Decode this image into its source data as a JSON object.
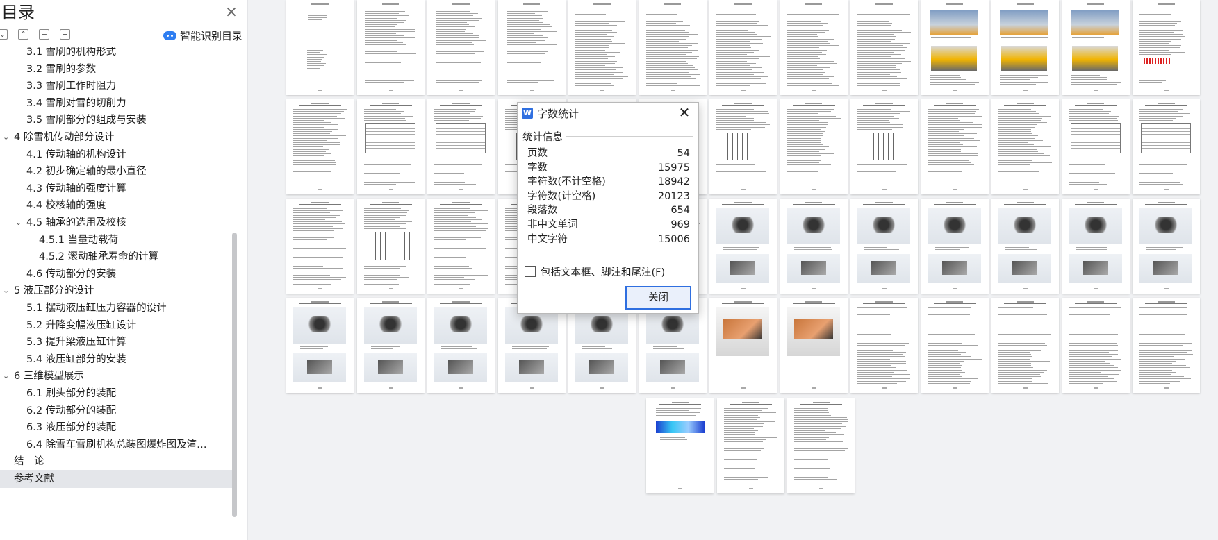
{
  "toc": {
    "title": "目录",
    "smart_toc_label": "智能识别目录",
    "items": [
      {
        "label": "3.1 雪刷的机构形式",
        "level": 1,
        "expandable": false,
        "selected": false
      },
      {
        "label": "3.2 雪刷的参数",
        "level": 1,
        "expandable": false,
        "selected": false
      },
      {
        "label": "3.3 雪刷工作时阻力",
        "level": 1,
        "expandable": false,
        "selected": false
      },
      {
        "label": "3.4 雪刷对雪的切削力",
        "level": 1,
        "expandable": false,
        "selected": false
      },
      {
        "label": "3.5 雪刷部分的组成与安装",
        "level": 1,
        "expandable": false,
        "selected": false
      },
      {
        "label": "4 除雪机传动部分设计",
        "level": 0,
        "expandable": true,
        "selected": false
      },
      {
        "label": "4.1 传动轴的机构设计",
        "level": 1,
        "expandable": false,
        "selected": false
      },
      {
        "label": "4.2 初步确定轴的最小直径",
        "level": 1,
        "expandable": false,
        "selected": false
      },
      {
        "label": "4.3 传动轴的强度计算",
        "level": 1,
        "expandable": false,
        "selected": false
      },
      {
        "label": "4.4 校核轴的强度",
        "level": 1,
        "expandable": false,
        "selected": false
      },
      {
        "label": "4.5 轴承的选用及校核",
        "level": 1,
        "expandable": true,
        "selected": false
      },
      {
        "label": "4.5.1 当量动载荷",
        "level": 2,
        "expandable": false,
        "selected": false
      },
      {
        "label": "4.5.2 滚动轴承寿命的计算",
        "level": 2,
        "expandable": false,
        "selected": false
      },
      {
        "label": "4.6 传动部分的安装",
        "level": 1,
        "expandable": false,
        "selected": false
      },
      {
        "label": "5 液压部分的设计",
        "level": 0,
        "expandable": true,
        "selected": false
      },
      {
        "label": "5.1 摆动液压缸压力容器的设计",
        "level": 1,
        "expandable": false,
        "selected": false
      },
      {
        "label": "5.2 升降变幅液压缸设计",
        "level": 1,
        "expandable": false,
        "selected": false
      },
      {
        "label": "5.3 提升梁液压缸计算",
        "level": 1,
        "expandable": false,
        "selected": false
      },
      {
        "label": "5.4 液压缸部分的安装",
        "level": 1,
        "expandable": false,
        "selected": false
      },
      {
        "label": "6 三维模型展示",
        "level": 0,
        "expandable": true,
        "selected": false
      },
      {
        "label": "6.1 刷头部分的装配",
        "level": 1,
        "expandable": false,
        "selected": false
      },
      {
        "label": "6.2 传动部分的装配",
        "level": 1,
        "expandable": false,
        "selected": false
      },
      {
        "label": "6.3 液压部分的装配",
        "level": 1,
        "expandable": false,
        "selected": false
      },
      {
        "label": "6.4 除雪车雪刷机构总装图爆炸图及渲…",
        "level": 1,
        "expandable": false,
        "selected": false
      },
      {
        "label": "结　论",
        "level": 0,
        "expandable": false,
        "selected": false
      },
      {
        "label": "参考文献",
        "level": 0,
        "expandable": false,
        "selected": true
      }
    ]
  },
  "dialog": {
    "title": "字数统计",
    "section_title": "统计信息",
    "stats": [
      {
        "label": "页数",
        "value": "54"
      },
      {
        "label": "字数",
        "value": "15975"
      },
      {
        "label": "字符数(不计空格)",
        "value": "18942"
      },
      {
        "label": "字符数(计空格)",
        "value": "20123"
      },
      {
        "label": "段落数",
        "value": "654"
      },
      {
        "label": "非中文单词",
        "value": "969"
      },
      {
        "label": "中文字符",
        "value": "15006"
      }
    ],
    "checkbox_label": "包括文本框、脚注和尾注(F)",
    "checkbox_checked": false,
    "close_button": "关闭"
  },
  "pages": {
    "total": 54,
    "kinds": [
      "cover",
      "abstract",
      "toc",
      "toc",
      "text",
      "text",
      "text",
      "text",
      "text",
      "photo",
      "photo",
      "photo",
      "chart",
      "text",
      "table",
      "table",
      "drawing",
      "text",
      "text",
      "drawing",
      "text",
      "drawing",
      "text",
      "text",
      "table",
      "table",
      "text",
      "drawing",
      "text",
      "text",
      "text",
      "text",
      "cad",
      "cad",
      "cad",
      "cad",
      "cad",
      "cad",
      "cad",
      "cad",
      "cad",
      "cad",
      "cad",
      "cad",
      "cad",
      "render",
      "render",
      "text",
      "text",
      "text",
      "text",
      "text",
      "fem",
      "text",
      "text"
    ]
  },
  "colors": {
    "accent": "#2f6fe0",
    "selected_row": "#e4e6ea",
    "workspace": "#f1f2f4"
  }
}
